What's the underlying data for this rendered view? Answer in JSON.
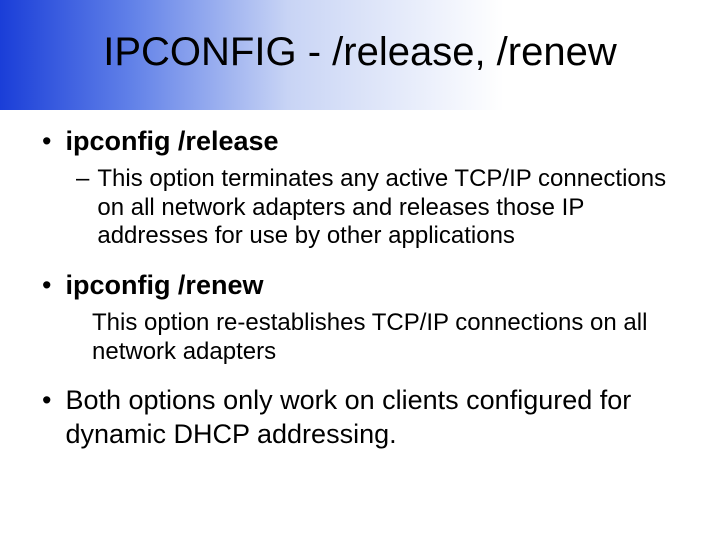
{
  "title": "IPCONFIG - /release, /renew",
  "bullets": {
    "b1": "ipconfig /release",
    "b1sub": "This option terminates any active TCP/IP connections on all network adapters and releases those IP addresses for use by other applications",
    "b2": "ipconfig /renew",
    "b2sub": "This option re-establishes TCP/IP connections on all network adapters",
    "b3": "Both options only work on clients configured for dynamic DHCP addressing."
  }
}
